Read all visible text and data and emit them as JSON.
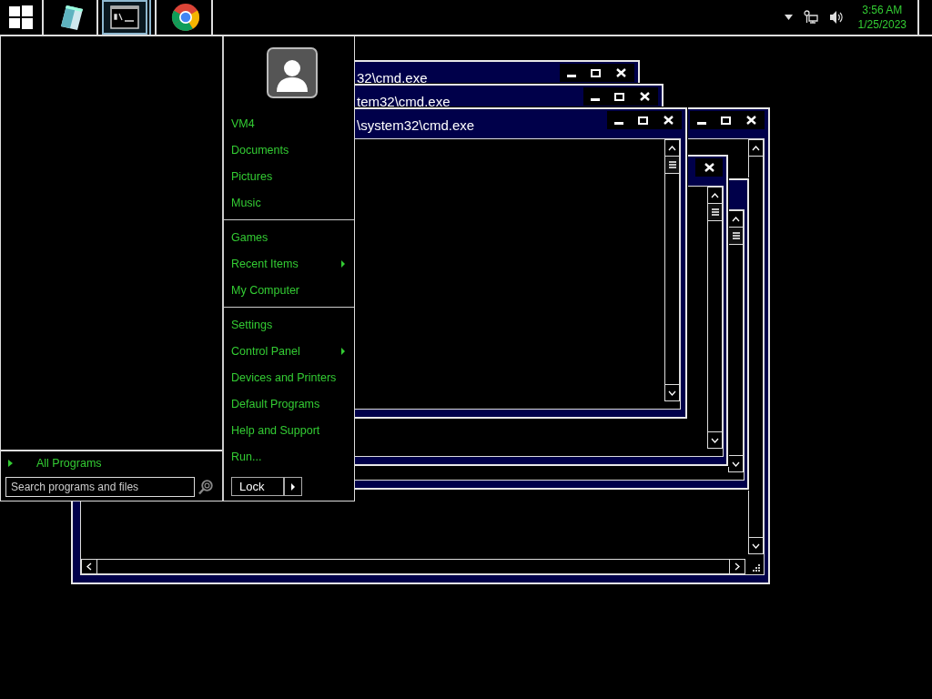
{
  "taskbar": {
    "buttons": [
      {
        "kind": "start",
        "selected": false
      },
      {
        "kind": "notepad",
        "selected": false
      },
      {
        "kind": "console",
        "selected": true
      },
      {
        "kind": "browser",
        "selected": false
      }
    ],
    "time": "3:56 AM",
    "date": "1/25/2023"
  },
  "windows": [
    {
      "title": "32\\cmd.exe"
    },
    {
      "title": "tem32\\cmd.exe"
    },
    {
      "title": "\\system32\\cmd.exe"
    }
  ],
  "start_menu": {
    "all_programs": "All Programs",
    "search": {
      "placeholder": "Search programs and files"
    },
    "groups": [
      [
        {
          "label": "VM4",
          "submenu": false
        },
        {
          "label": "Documents",
          "submenu": false
        },
        {
          "label": "Pictures",
          "submenu": false
        },
        {
          "label": "Music",
          "submenu": false
        }
      ],
      [
        {
          "label": "Games",
          "submenu": false
        },
        {
          "label": "Recent Items",
          "submenu": true
        },
        {
          "label": "My Computer",
          "submenu": false
        }
      ],
      [
        {
          "label": "Settings",
          "submenu": false
        },
        {
          "label": "Control Panel",
          "submenu": true
        },
        {
          "label": "Devices and Printers",
          "submenu": false
        },
        {
          "label": "Default Programs",
          "submenu": false
        },
        {
          "label": "Help and Support",
          "submenu": false
        },
        {
          "label": "Run...",
          "submenu": false
        }
      ]
    ],
    "lock": "Lock"
  }
}
